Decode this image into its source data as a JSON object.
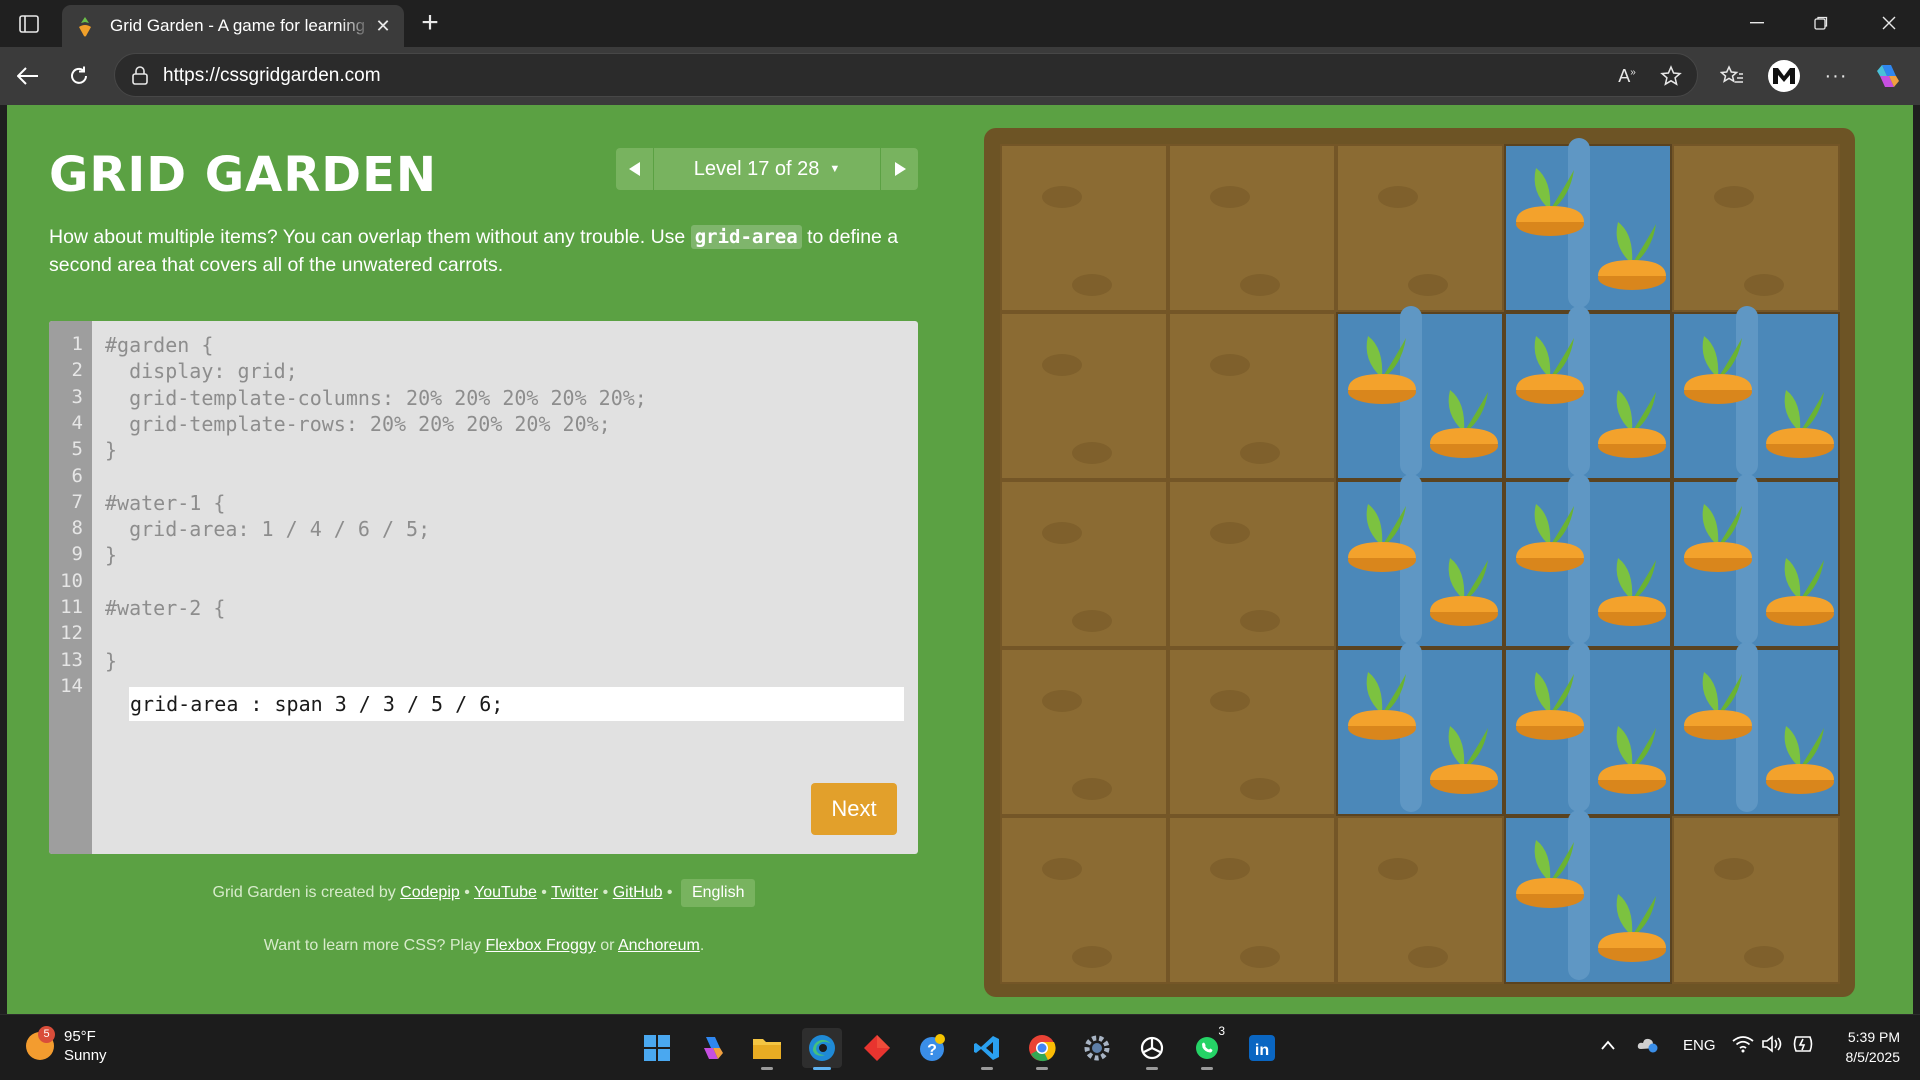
{
  "browser": {
    "tab_title": "Grid Garden - A game for learning CSS grid",
    "url": "https://cssgridgarden.com"
  },
  "game": {
    "title": "GRID GARDEN",
    "level_label": "Level 17 of 28",
    "instructions_before": "How about multiple items? You can overlap them without any trouble. Use ",
    "instructions_code": "grid-area",
    "instructions_after": " to define a second area that covers all of the unwatered carrots.",
    "line_numbers": [
      "1",
      "2",
      "3",
      "4",
      "5",
      "6",
      "7",
      "8",
      "9",
      "10",
      "11",
      "12",
      "13",
      "14"
    ],
    "code_lines": [
      "#garden {",
      "  display: grid;",
      "  grid-template-columns: 20% 20% 20% 20% 20%;",
      "  grid-template-rows: 20% 20% 20% 20% 20%;",
      "}",
      "",
      "#water-1 {",
      "  grid-area: 1 / 4 / 6 / 5;",
      "}",
      "",
      "#water-2 {",
      "",
      "}",
      ""
    ],
    "answer_value": "grid-area : span 3 / 3 / 5 / 6;",
    "next_label": "Next",
    "credits_prefix": "Grid Garden is created by",
    "credits_links": [
      "Codepip",
      "YouTube",
      "Twitter",
      "GitHub"
    ],
    "language_label": "English",
    "promo_prefix": "Want to learn more CSS? Play",
    "promo_link_1": "Flexbox Froggy",
    "promo_or": "or",
    "promo_link_2": "Anchoreum",
    "promo_suffix": "."
  },
  "taskbar": {
    "weather_badge": "5",
    "temperature": "95°F",
    "condition": "Sunny",
    "whatsapp_badge": "3",
    "language": "ENG",
    "time": "5:39 PM",
    "date": "8/5/2025"
  },
  "colors": {
    "page_bg": "#5ba143",
    "soil": "#8b6b33",
    "water": "#4b88b9",
    "next_button": "#e2a02b"
  }
}
